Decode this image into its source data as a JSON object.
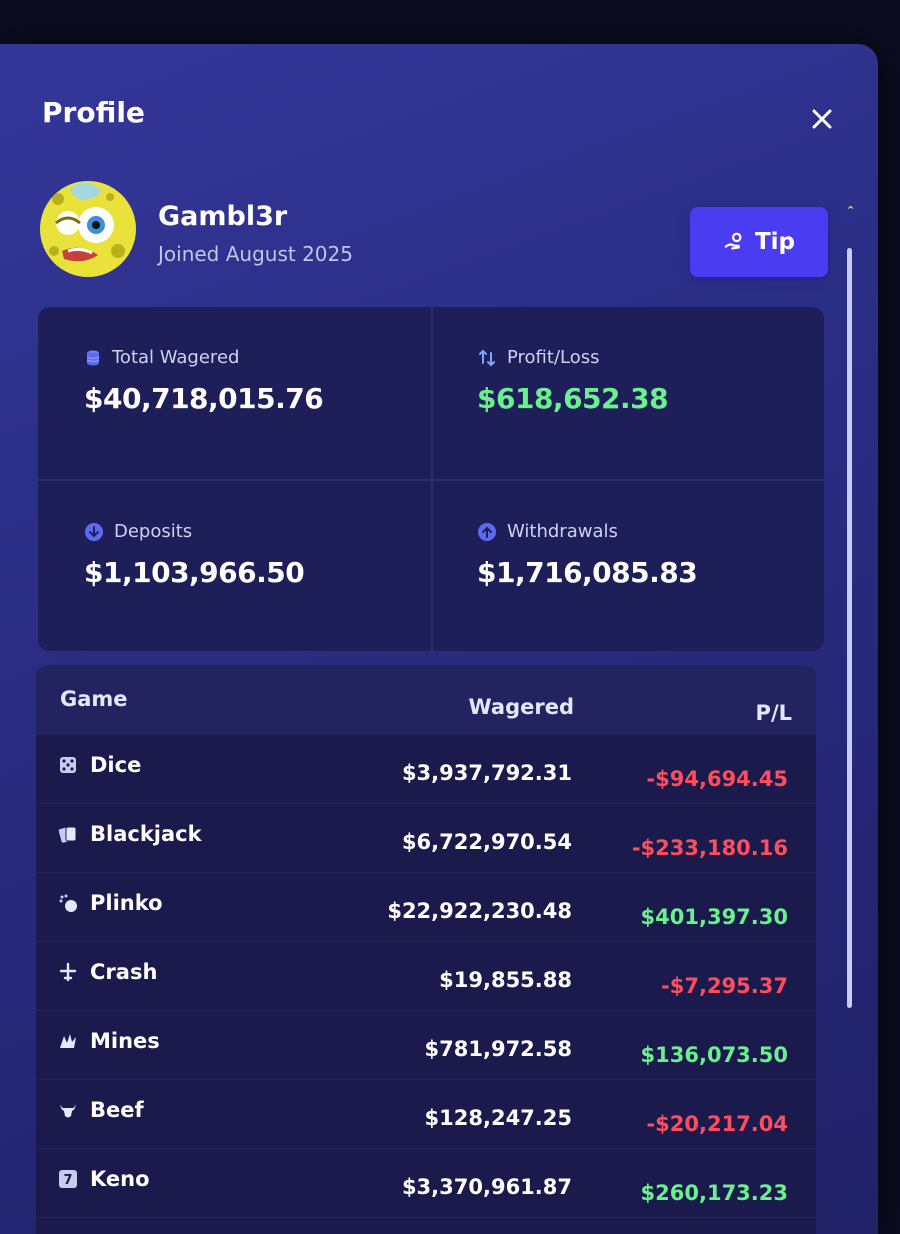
{
  "modal": {
    "title": "Profile"
  },
  "user": {
    "username": "Gambl3r",
    "joined": "Joined August 2025",
    "avatar_description": "spongebob-avatar"
  },
  "tip_button": {
    "label": "Tip",
    "icon": "tip-hand-icon"
  },
  "stats": {
    "total_wagered": {
      "label": "Total Wagered",
      "value": "$40,718,015.76",
      "icon": "coin-stack-icon"
    },
    "profit_loss": {
      "label": "Profit/Loss",
      "value": "$618,652.38",
      "icon": "arrows-exchange-icon",
      "color": "#6af08e"
    },
    "deposits": {
      "label": "Deposits",
      "value": "$1,103,966.50",
      "icon": "arrow-down-circle-icon"
    },
    "withdrawals": {
      "label": "Withdrawals",
      "value": "$1,716,085.83",
      "icon": "arrow-up-circle-icon"
    }
  },
  "games_table": {
    "headers": {
      "game": "Game",
      "wagered": "Wagered",
      "pl": "P/L"
    },
    "rows": [
      {
        "name": "Dice",
        "icon": "dice-icon",
        "wagered": "$3,937,792.31",
        "pl": "-$94,694.45",
        "sign": "neg"
      },
      {
        "name": "Blackjack",
        "icon": "cards-icon",
        "wagered": "$6,722,970.54",
        "pl": "-$233,180.16",
        "sign": "neg"
      },
      {
        "name": "Plinko",
        "icon": "plinko-icon",
        "wagered": "$22,922,230.48",
        "pl": "$401,397.30",
        "sign": "pos"
      },
      {
        "name": "Crash",
        "icon": "plane-icon",
        "wagered": "$19,855.88",
        "pl": "-$7,295.37",
        "sign": "neg"
      },
      {
        "name": "Mines",
        "icon": "mine-icon",
        "wagered": "$781,972.58",
        "pl": "$136,073.50",
        "sign": "pos"
      },
      {
        "name": "Beef",
        "icon": "bull-icon",
        "wagered": "$128,247.25",
        "pl": "-$20,217.04",
        "sign": "neg"
      },
      {
        "name": "Keno",
        "icon": "keno-icon",
        "wagered": "$3,370,961.87",
        "pl": "$260,173.23",
        "sign": "pos"
      }
    ]
  },
  "colors": {
    "positive": "#6af08e",
    "negative": "#ff4d5e",
    "accent": "#4a3cf0",
    "panel": "#1e1e58"
  }
}
